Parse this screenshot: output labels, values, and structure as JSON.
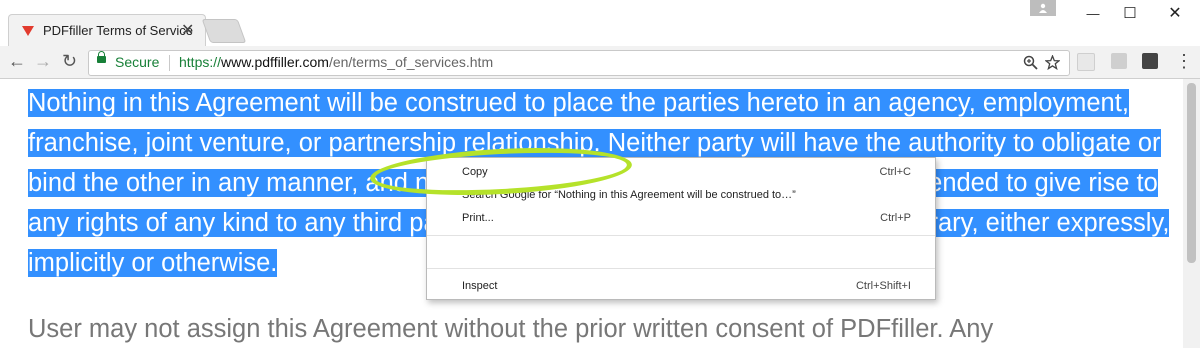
{
  "tab": {
    "title": "PDFfiller Terms of Service",
    "close_glyph": "✕"
  },
  "window": {
    "minimize": "—",
    "maximize": "☐",
    "close": "✕"
  },
  "toolbar": {
    "back": "←",
    "forward": "→",
    "reload": "↻",
    "secure_label": "Secure",
    "url_protocol": "https://",
    "url_host": "www.pdffiller.com",
    "url_path": "/en/terms_of_services.htm",
    "menu_glyph": "⋮"
  },
  "content": {
    "selected_paragraph": "Nothing in this Agreement will be construed to place the parties hereto in an agency, employment, franchise, joint venture, or partnership relationship. Neither party will have the authority to obligate or bind the other in any manner, and nothing herein contained will give rise or is intended to give rise to any rights of any kind to any third parties. Neither party will represent to the contrary, either expressly, implicitly or otherwise.",
    "next_paragraph": "User may not assign this Agreement without the prior written consent of PDFfiller. Any"
  },
  "context_menu": {
    "copy": {
      "label": "Copy",
      "shortcut": "Ctrl+C"
    },
    "search": {
      "label": "Search Google for “Nothing in this Agreement will be construed to…”"
    },
    "print": {
      "label": "Print...",
      "shortcut": "Ctrl+P"
    },
    "inspect": {
      "label": "Inspect",
      "shortcut": "Ctrl+Shift+I"
    }
  },
  "colors": {
    "selection": "#3390ff",
    "secure_green": "#188038",
    "annotation_ellipse": "#b5e22a",
    "brand_red": "#e23b2e"
  }
}
